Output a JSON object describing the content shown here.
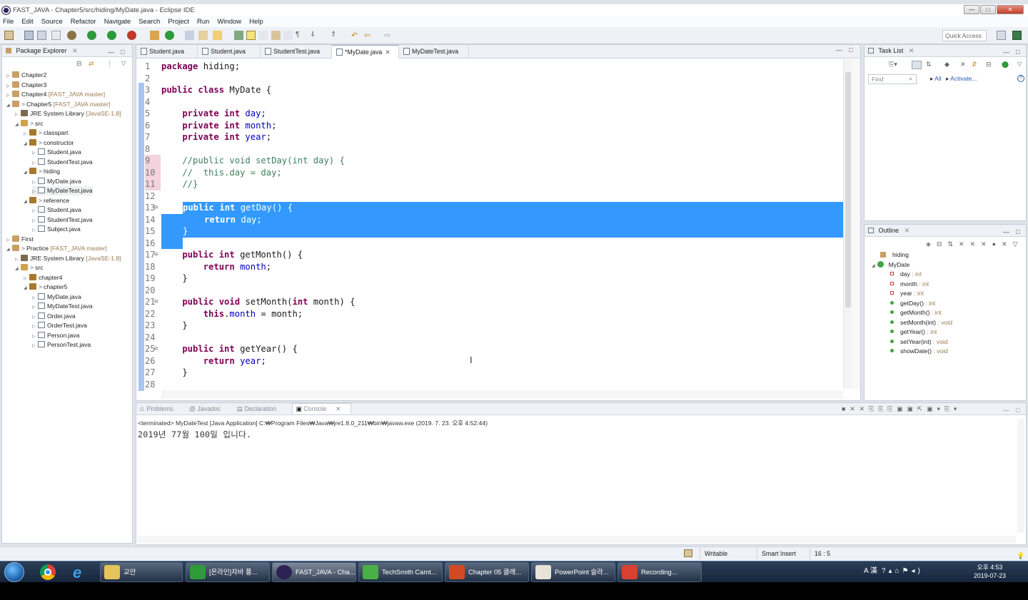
{
  "window": {
    "title": "FAST_JAVA - Chapter5/src/hiding/MyDate.java - Eclipse IDE",
    "min": "—",
    "max": "□",
    "close": "✕"
  },
  "menu": [
    "File",
    "Edit",
    "Source",
    "Refactor",
    "Navigate",
    "Search",
    "Project",
    "Run",
    "Window",
    "Help"
  ],
  "quick_access": {
    "placeholder": "Quick Access"
  },
  "package_explorer": {
    "title": "Package Explorer",
    "nodes": [
      {
        "label": "Chapter2",
        "extra": ""
      },
      {
        "label": "Chapter3",
        "extra": ""
      },
      {
        "label": "Chapter4",
        "extra": "[FAST_JAVA master]"
      },
      {
        "label": "Chapter5",
        "extra": "[FAST_JAVA master]",
        "prefix": ">"
      },
      {
        "label": "JRE System Library",
        "extra": "[JavaSE-1.8]"
      },
      {
        "label": "src",
        "prefix": ">"
      },
      {
        "label": "classpart",
        "prefix": ">"
      },
      {
        "label": "constructor",
        "prefix": ">"
      },
      {
        "label": "Student.java"
      },
      {
        "label": "StudentTest.java"
      },
      {
        "label": "hiding",
        "prefix": ">"
      },
      {
        "label": "MyDate.java"
      },
      {
        "label": "MyDateTest.java"
      },
      {
        "label": "reference",
        "prefix": ">"
      },
      {
        "label": "Student.java"
      },
      {
        "label": "StudentTest.java"
      },
      {
        "label": "Subject.java"
      },
      {
        "label": "First"
      },
      {
        "label": "Practice",
        "extra": "[FAST_JAVA master]",
        "prefix": ">"
      },
      {
        "label": "JRE System Library",
        "extra": "[JavaSE-1.8]"
      },
      {
        "label": "src",
        "prefix": ">"
      },
      {
        "label": "chapter4"
      },
      {
        "label": "chapter5",
        "prefix": ">"
      },
      {
        "label": "MyDate.java"
      },
      {
        "label": "MyDateTest.java"
      },
      {
        "label": "Order.java"
      },
      {
        "label": "OrderTest.java"
      },
      {
        "label": "Person.java"
      },
      {
        "label": "PersonTest.java"
      }
    ]
  },
  "editor": {
    "tabs": [
      "Student.java",
      "Student.java",
      "StudentTest.java",
      "*MyDate.java",
      "MyDateTest.java"
    ],
    "active_tab": 3,
    "lines": [
      "1",
      "2",
      "3",
      "4",
      "5",
      "6",
      "7",
      "8",
      "9",
      "10",
      "11",
      "12",
      "13",
      "14",
      "15",
      "16",
      "17",
      "18",
      "19",
      "20",
      "21",
      "22",
      "23",
      "24",
      "25",
      "26",
      "27",
      "28"
    ],
    "code": {
      "l1a": "package",
      "l1b": " hiding;",
      "l3a": "public class",
      "l3b": " MyDate {",
      "l5a": "    private int",
      "l5b": "day",
      "l5c": ";",
      "l6a": "    private int",
      "l6b": "month",
      "l6c": ";",
      "l7a": "    private int",
      "l7b": "year",
      "l7c": ";",
      "l9": "    //public void setDay(int day) {",
      "l10": "    //  this.day = day;",
      "l11": "    //}",
      "l13a": "public int",
      "l13b": " getDay() {",
      "l14a": "return",
      "l14b": " day;",
      "l15": "}",
      "l17a": "    public int",
      "l17b": " getMonth() {",
      "l18a": "        return",
      "l18b": "month",
      "l18c": ";",
      "l19": "    }",
      "l21a": "    public void",
      "l21b": " setMonth(",
      "l21c": "int",
      "l21d": " month) {",
      "l22a": "        this",
      "l22b": ".",
      "l22c": "month",
      "l22d": " = month;",
      "l23": "    }",
      "l25a": "    public int",
      "l25b": " getYear() {",
      "l26a": "        return",
      "l26b": "year",
      "l26c": ";",
      "l27": "    }"
    }
  },
  "task_list": {
    "title": "Task List",
    "find_placeholder": "Find",
    "all": "All",
    "activate": "Activate..."
  },
  "outline": {
    "title": "Outline",
    "package": "hiding",
    "class": "MyDate",
    "members": [
      {
        "name": "day",
        "type": " : int",
        "kind": "field"
      },
      {
        "name": "month",
        "type": " : int",
        "kind": "field"
      },
      {
        "name": "year",
        "type": " : int",
        "kind": "field"
      },
      {
        "name": "getDay()",
        "type": " : int",
        "kind": "method"
      },
      {
        "name": "getMonth()",
        "type": " : int",
        "kind": "method"
      },
      {
        "name": "setMonth(int)",
        "type": " : void",
        "kind": "method"
      },
      {
        "name": "getYear()",
        "type": " : int",
        "kind": "method"
      },
      {
        "name": "setYear(int)",
        "type": " : void",
        "kind": "method"
      },
      {
        "name": "showDate()",
        "type": " : void",
        "kind": "method"
      }
    ]
  },
  "console": {
    "tabs": [
      "Problems",
      "Javadoc",
      "Declaration",
      "Console"
    ],
    "terminated": "<terminated> MyDateTest [Java Application] C:₩Program Files₩Java₩jre1.8.0_211₩bin₩javaw.exe (2019. 7. 23. 오후 4:52:44)",
    "output": "2019년 77월 100일 입니다."
  },
  "status": {
    "writable": "Writable",
    "insert": "Smart Insert",
    "position": "16 : 5"
  },
  "taskbar": {
    "buttons": [
      "교안",
      "[온라인]자바 플...",
      "FAST_JAVA - Cha...",
      "TechSmith Camt...",
      "Chapter 05 클래...",
      "PowerPoint 슬라...",
      "Recording..."
    ],
    "tray": "A 漢",
    "time": "오후 4:53",
    "date": "2019-07-23"
  },
  "colors": {
    "selection": "#3399ff",
    "keyword": "#7f0055",
    "field": "#0000c0",
    "comment": "#3f7f5f"
  }
}
